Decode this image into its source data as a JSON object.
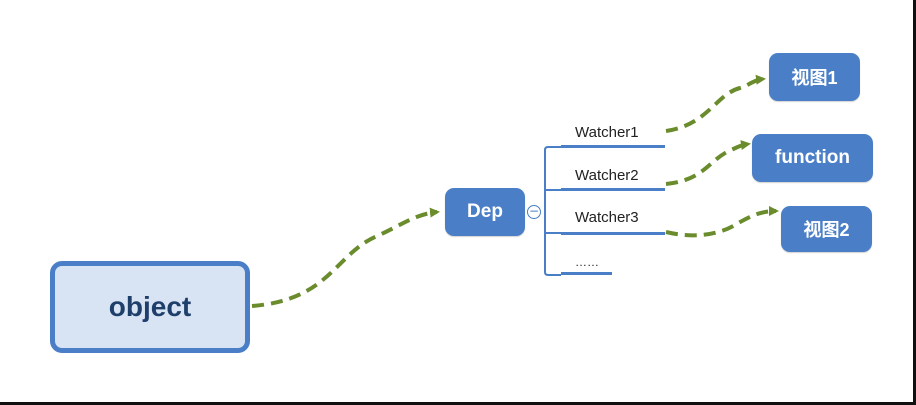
{
  "diagram": {
    "nodes": {
      "object": "object",
      "dep": "Dep",
      "view1": "视图1",
      "function": "function",
      "view2": "视图2"
    },
    "watchers": [
      "Watcher1",
      "Watcher2",
      "Watcher3",
      "……"
    ],
    "toggle": "−",
    "colors": {
      "node_fill": "#4a7fc7",
      "object_fill": "#d8e3f3",
      "object_border": "#4a7fc7",
      "arrow": "#6a8c2d",
      "tree_line": "#4a7fc7"
    },
    "edges": [
      {
        "from": "object",
        "to": "dep"
      },
      {
        "from": "Watcher1",
        "to": "视图1"
      },
      {
        "from": "Watcher2",
        "to": "function"
      },
      {
        "from": "Watcher3",
        "to": "视图2"
      }
    ]
  }
}
